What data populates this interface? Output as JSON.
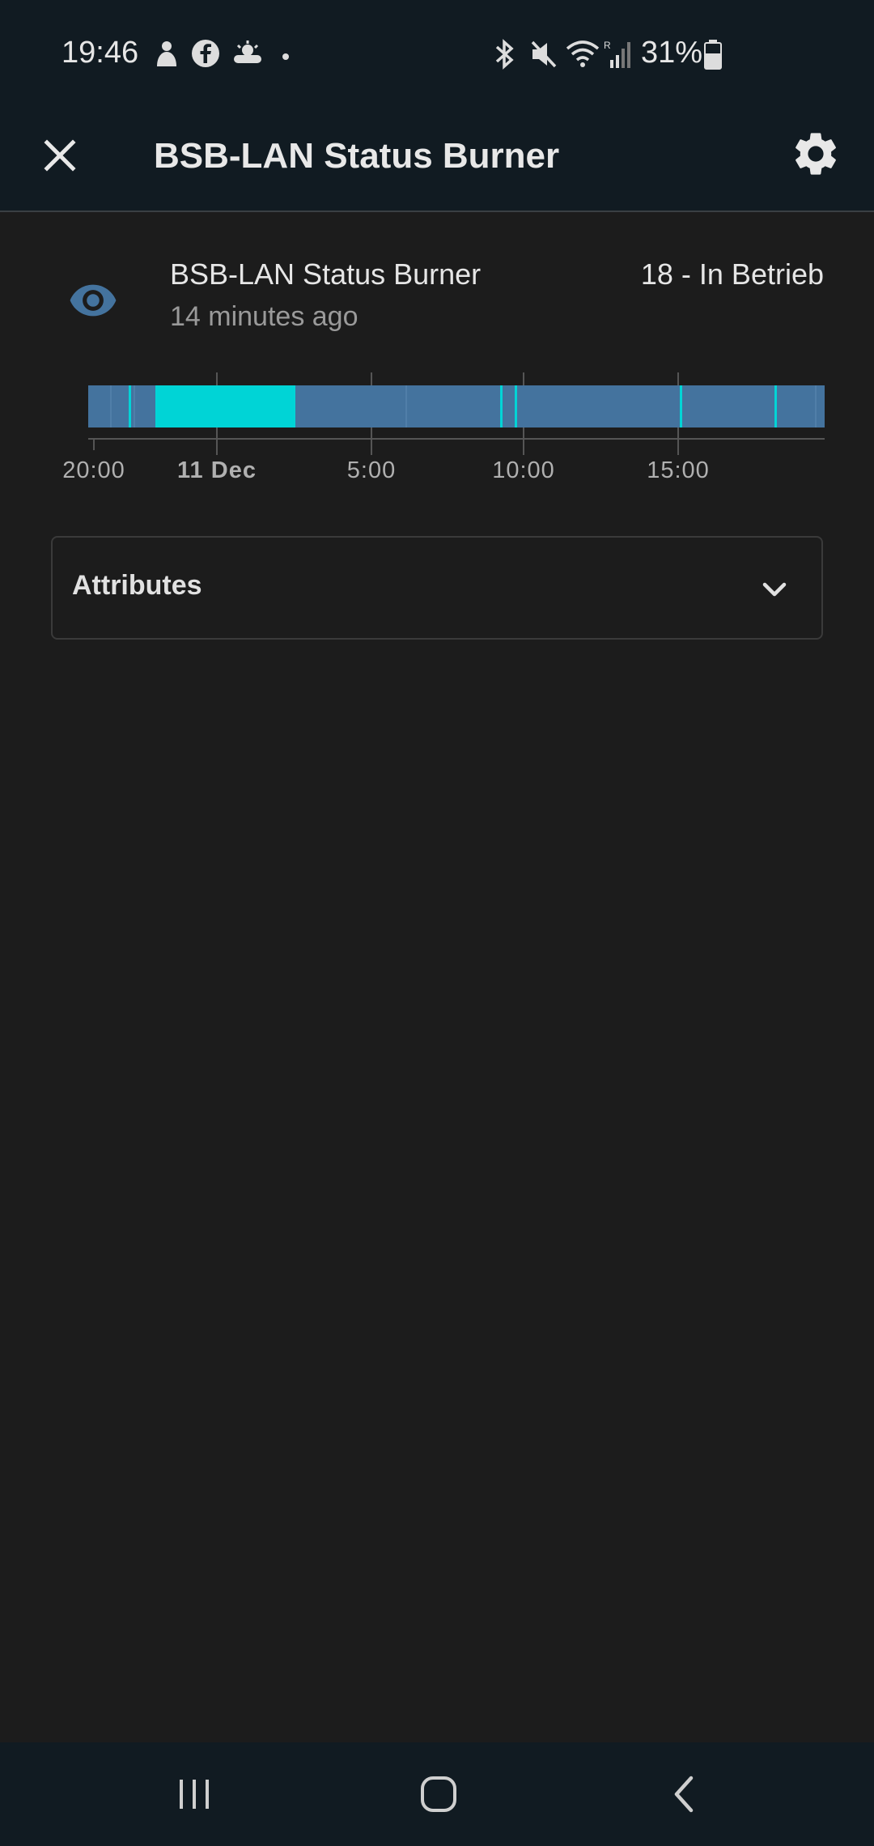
{
  "status_bar": {
    "time": "19:46",
    "battery": "31%",
    "icons_left": [
      "quick-icon",
      "facebook-icon",
      "weather-icon",
      "dot-icon"
    ],
    "icons_right": [
      "bluetooth-icon",
      "mute-icon",
      "wifi-icon",
      "signal-icon",
      "battery-icon"
    ]
  },
  "app_bar": {
    "title": "BSB-LAN Status Burner",
    "close_icon": "close-icon",
    "settings_icon": "gear-icon"
  },
  "entity": {
    "name": "BSB-LAN Status Burner",
    "last_changed": "14 minutes ago",
    "state": "18 - In Betrieb",
    "icon": "eye-icon",
    "icon_color": "#44739e"
  },
  "timeline": {
    "colors": {
      "base": "#44739e",
      "highlight": "#00d4d6"
    },
    "tick_labels": [
      "20:00",
      "11 Dec",
      "5:00",
      "10:00",
      "15:00"
    ]
  },
  "attributes": {
    "label": "Attributes",
    "icon": "chevron-down-icon"
  },
  "nav": {
    "recent_icon": "recent-apps-icon",
    "home_icon": "home-icon",
    "back_icon": "back-icon"
  }
}
